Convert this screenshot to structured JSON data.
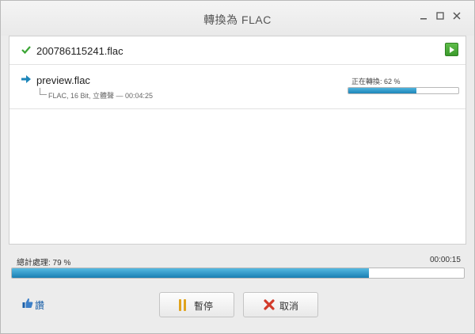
{
  "window": {
    "title": "轉換為 FLAC"
  },
  "files": {
    "completed": {
      "name": "200786115241.flac"
    },
    "active": {
      "name": "preview.flac",
      "meta": "FLAC, 16 Bit, 立體聲 — 00:04:25",
      "status_label": "正在轉換: 62 %",
      "progress": 0.62
    }
  },
  "total": {
    "label": "總計處理: 79 %",
    "progress": 0.79,
    "elapsed": "00:00:15"
  },
  "actions": {
    "like_label": "讚",
    "pause_label": "暫停",
    "cancel_label": "取消"
  },
  "colors": {
    "accent": "#1d86ba",
    "success": "#3aa534",
    "cancel": "#d23a2a",
    "pause": "#e0a31c",
    "link": "#1a5fa8"
  }
}
